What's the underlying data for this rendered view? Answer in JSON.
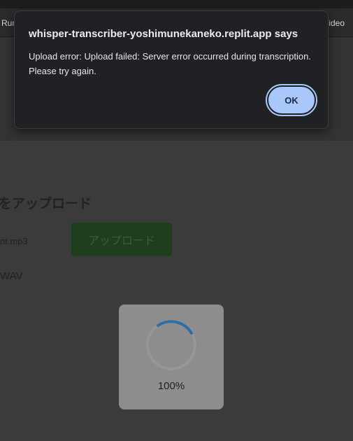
{
  "browser": {
    "bookmark_left": "Run",
    "bookmark_right": "ideo"
  },
  "page": {
    "section_title": "をアップロード",
    "file_name": "nt.mp3",
    "upload_button": "アップロード",
    "formats_text": "WAV",
    "progress": {
      "percent": 100,
      "label": "100%"
    }
  },
  "dialog": {
    "title": "whisper-transcriber-yoshimunekaneko.replit.app says",
    "message": "Upload error: Upload failed: Server error occurred during transcription. Please try again.",
    "ok_label": "OK"
  },
  "colors": {
    "accent": "#a8c7fa",
    "dialog_bg": "#202124",
    "upload_button_bg": "#1d3f1e",
    "spinner_arc": "#2e6da8"
  },
  "icons": {
    "spinner": "loading-spinner-icon"
  }
}
